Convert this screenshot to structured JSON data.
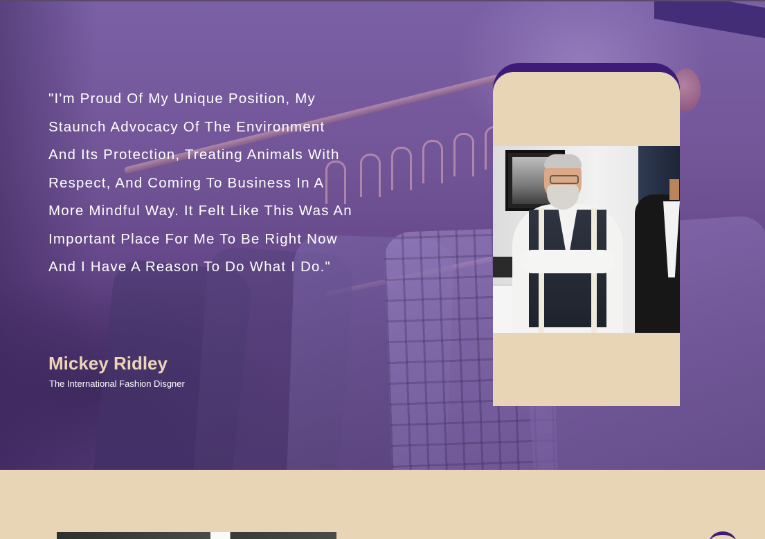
{
  "testimonial": {
    "quote": "\"I'm Proud Of My Unique Position, My Staunch Advocacy Of The Environment And Its Protection, Treating Animals With Respect, And Coming To Business In A More Mindful Way. It Felt Like This Was An Important Place For Me To Be Right Now And I Have A Reason To Do What I Do.\"",
    "author_name": "Mickey Ridley",
    "author_title": "The International Fashion Disgner"
  },
  "colors": {
    "accent_purple": "#3d1c78",
    "hero_purple": "#725597",
    "beige": "#e8d5b5",
    "author_name": "#ecd4b4"
  }
}
